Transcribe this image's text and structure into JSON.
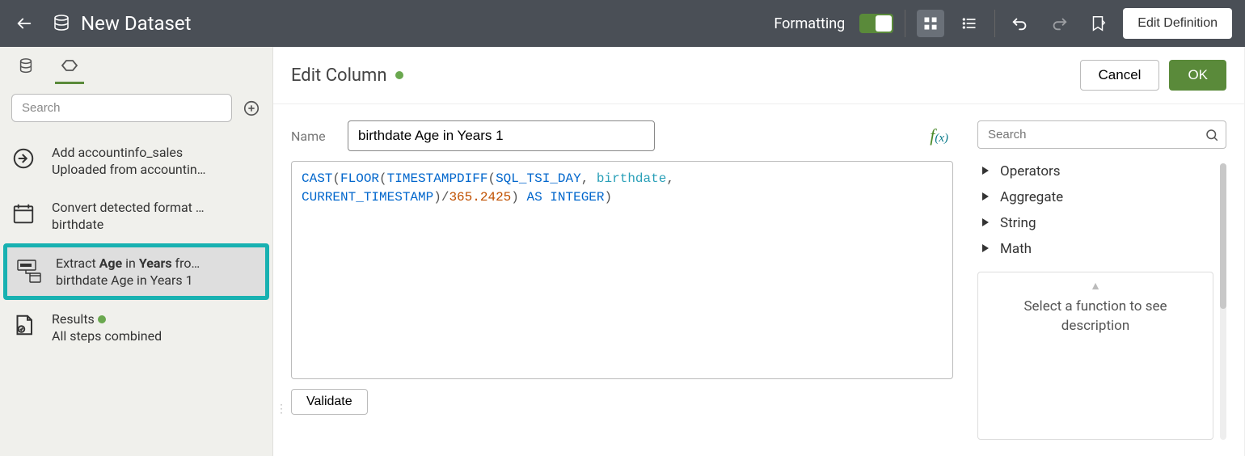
{
  "topbar": {
    "title": "New Dataset",
    "formatting_label": "Formatting",
    "edit_def_label": "Edit Definition"
  },
  "sidebar": {
    "search_placeholder": "Search",
    "steps": [
      {
        "line1": "Add accountinfo_sales",
        "line2": "Uploaded from accountin…"
      },
      {
        "line1": "Convert detected format …",
        "line2": "birthdate"
      },
      {
        "line1_prefix": "Extract ",
        "line1_b1": "Age",
        "line1_mid": " in ",
        "line1_b2": "Years",
        "line1_suffix": " fro…",
        "line2": "birthdate Age in Years 1"
      },
      {
        "line1": "Results",
        "line2": "All steps combined"
      }
    ]
  },
  "main": {
    "header_title": "Edit Column",
    "cancel_label": "Cancel",
    "ok_label": "OK",
    "name_label": "Name",
    "name_value": "birthdate Age in Years 1",
    "validate_label": "Validate",
    "expression_tokens": [
      {
        "t": "kw",
        "v": "CAST"
      },
      {
        "t": "par",
        "v": "("
      },
      {
        "t": "kw",
        "v": "FLOOR"
      },
      {
        "t": "par",
        "v": "("
      },
      {
        "t": "kw",
        "v": "TIMESTAMPDIFF"
      },
      {
        "t": "par",
        "v": "("
      },
      {
        "t": "kw",
        "v": "SQL_TSI_DAY"
      },
      {
        "t": "op",
        "v": ", "
      },
      {
        "t": "col",
        "v": "birthdate"
      },
      {
        "t": "op",
        "v": ", "
      },
      {
        "t": "nl",
        "v": "\n"
      },
      {
        "t": "kw",
        "v": "CURRENT_TIMESTAMP"
      },
      {
        "t": "par",
        "v": ")"
      },
      {
        "t": "div",
        "v": "/"
      },
      {
        "t": "num",
        "v": "365.2425"
      },
      {
        "t": "par",
        "v": ")"
      },
      {
        "t": "op",
        "v": " "
      },
      {
        "t": "kw",
        "v": "AS"
      },
      {
        "t": "op",
        "v": " "
      },
      {
        "t": "kw",
        "v": "INTEGER"
      },
      {
        "t": "par",
        "v": ")"
      }
    ]
  },
  "right": {
    "search_placeholder": "Search",
    "categories": [
      "Operators",
      "Aggregate",
      "String",
      "Math"
    ],
    "desc_text": "Select a function to see description"
  }
}
